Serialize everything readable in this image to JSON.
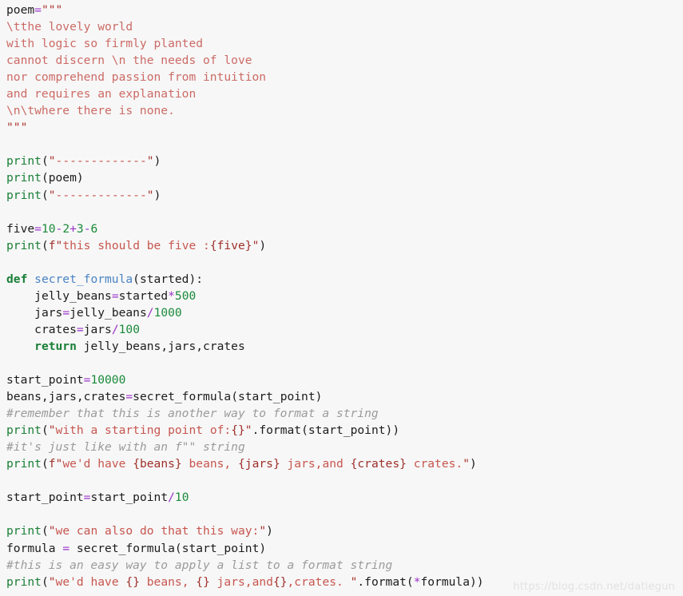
{
  "editor": {
    "background_color": "#f7f7f7",
    "default_text_color": "#1c1c1c",
    "language": "python",
    "font_size_px": 14.6,
    "line_height_px": 21.05
  },
  "palette": {
    "keyword": "#1a7f37",
    "builtin_function": "#1a7f37",
    "function_name": "#4a83c4",
    "string": "#c7564f",
    "string_dark": "#9e2f2a",
    "docstring": "#cc6b66",
    "number": "#1a8a3a",
    "operator": "#9a32c8",
    "comment": "#9b9b9b",
    "plain": "#1c1c1c",
    "watermark": "#e2e2e2"
  },
  "code": {
    "lines": [
      "poem=\"\"\"",
      "\\tthe lovely world",
      "with logic so firmly planted",
      "cannot discern \\n the needs of love",
      "nor comprehend passion from intuition",
      "and requires an explanation",
      "\\n\\twhere there is none.",
      "\"\"\"",
      "",
      "print(\"-------------\")",
      "print(poem)",
      "print(\"-------------\")",
      "",
      "five=10-2+3-6",
      "print(f\"this should be five :{five}\")",
      "",
      "def secret_formula(started):",
      "    jelly_beans=started*500",
      "    jars=jelly_beans/1000",
      "    crates=jars/100",
      "    return jelly_beans,jars,crates",
      "",
      "start_point=10000",
      "beans,jars,crates=secret_formula(start_point)",
      "#remember that this is another way to format a string",
      "print(\"with a starting point of:{}\".format(start_point))",
      "#it's just like with an f\"\" string",
      "print(f\"we'd have {beans} beans, {jars} jars,and {crates} crates.\")",
      "",
      "start_point=start_point/10",
      "",
      "print(\"we can also do that this way:\")",
      "formula = secret_formula(start_point)",
      "#this is an easy way to apply a list to a format string",
      "print(\"we'd have {} beans, {} jars,and{},crates.\".format(*formula))"
    ],
    "tokens": {
      "l1": {
        "name": "poem",
        "assign": "=",
        "quote": "\"\"\""
      },
      "l2": "\\tthe lovely world",
      "l3": "with logic so firmly planted",
      "l4": "cannot discern \\n the needs of love",
      "l5": "nor comprehend passion from intuition",
      "l6": "and requires an explanation",
      "l7": "\\n\\twhere there is none.",
      "l8": "\"\"\"",
      "print_fn": "print",
      "dashes": "-------------",
      "poem_ref": "poem",
      "five_name": "five",
      "five_expr": {
        "n1": "10",
        "op1": "-",
        "n2": "2",
        "op2": "+",
        "n3": "3",
        "op3": "-",
        "n4": "6"
      },
      "fstr_five": {
        "prefix": "f",
        "open": "\"",
        "text": "this should be five :",
        "brace_open": "{",
        "var": "five",
        "brace_close": "}",
        "close": "\""
      },
      "def_kw": "def",
      "func_name": "secret_formula",
      "func_arg": "started",
      "jelly_beans": "jelly_beans",
      "started": "started",
      "star": "*",
      "n500": "500",
      "jars": "jars",
      "slash": "/",
      "n1000": "1000",
      "crates": "crates",
      "n100": "100",
      "return_kw": "return",
      "return_vals": "jelly_beans,jars,crates",
      "start_point": "start_point",
      "n10000": "10000",
      "unpack_targets": "beans,jars,crates",
      "comment_remember": "#remember that this is another way to format a string",
      "str_starting_point": "with a starting point of:",
      "empty_braces": "{}",
      "format_attr": ".format",
      "comment_its_just": "#it's just like with an f\"\" string",
      "fstr_wed_have": {
        "prefix": "f",
        "text1": "we'd have ",
        "b1": "{beans}",
        "text2": " beans, ",
        "b2": "{jars}",
        "text3": " jars,and ",
        "b3": "{crates}",
        "text4": " crates."
      },
      "n10": "10",
      "str_we_can_also": "we can also do that this way:",
      "formula_name": "formula",
      "equals_spaced": "=",
      "comment_easy_way": "#this is an easy way to apply a list to a format string",
      "str_wed_have_braces": {
        "text1": "we'd have ",
        "b1": "{}",
        "text2": " beans, ",
        "b2": "{}",
        "text3": " jars,and",
        "b3": "{}",
        "text4": ",crates. "
      },
      "formula_ref": "formula"
    }
  },
  "watermark": {
    "text": "https://blog.csdn.net/datiegun"
  }
}
